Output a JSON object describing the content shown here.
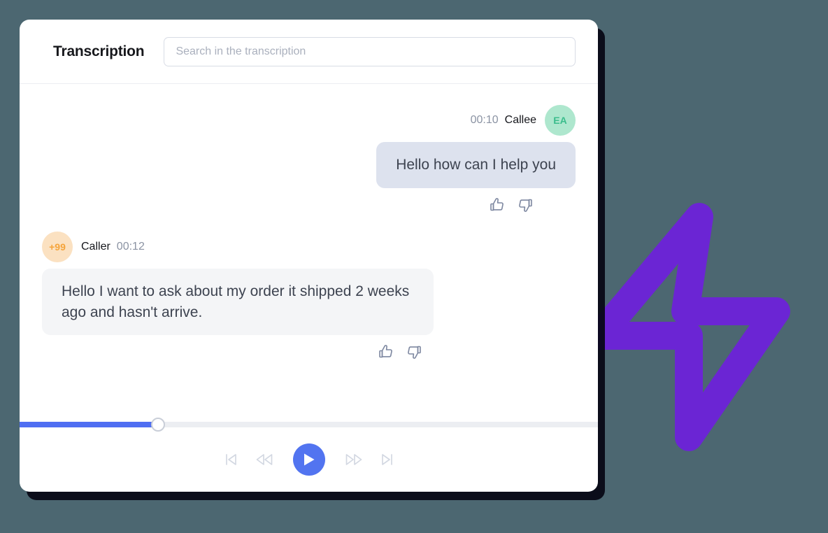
{
  "theme": {
    "page_background": "#4c6771",
    "card_background": "#ffffff",
    "accent_blue": "#4f6ef2",
    "play_button_color": "#5274f0",
    "bolt_purple": "#6b25d4",
    "callee_bubble_color": "#dde2ee",
    "caller_bubble_color": "#f4f5f7",
    "callee_avatar_bg": "#aee7ce",
    "callee_avatar_fg": "#3bbd8c",
    "caller_avatar_bg": "#fbe1c1",
    "caller_avatar_fg": "#f5a43a",
    "icon_gray": "#7d87a0"
  },
  "header": {
    "title": "Transcription",
    "search": {
      "placeholder": "Search in the transcription",
      "value": ""
    }
  },
  "transcript": {
    "messages": [
      {
        "id": "msg-callee-1",
        "direction": "outgoing",
        "speaker": "Callee",
        "timestamp": "00:10",
        "avatar_initials": "EA",
        "avatar_style": "green",
        "text": "Hello how can I help you",
        "reactions": [
          "thumbs-up-icon",
          "thumbs-down-icon"
        ]
      },
      {
        "id": "msg-caller-1",
        "direction": "incoming",
        "speaker": "Caller",
        "timestamp": "00:12",
        "avatar_initials": "+99",
        "avatar_style": "orange",
        "text": "Hello I want to ask about my order it shipped 2 weeks ago and hasn't arrive.",
        "reactions": [
          "thumbs-up-icon",
          "thumbs-down-icon"
        ]
      }
    ]
  },
  "player": {
    "progress_percent": 24,
    "controls": [
      {
        "name": "skip-to-start-button",
        "icon": "skip-back-icon"
      },
      {
        "name": "rewind-button",
        "icon": "rewind-icon"
      },
      {
        "name": "play-button",
        "icon": "play-icon"
      },
      {
        "name": "fast-forward-button",
        "icon": "fast-forward-icon"
      },
      {
        "name": "skip-to-end-button",
        "icon": "skip-forward-icon"
      }
    ]
  },
  "decoration": {
    "graphic": "lightning-bolt-icon"
  }
}
